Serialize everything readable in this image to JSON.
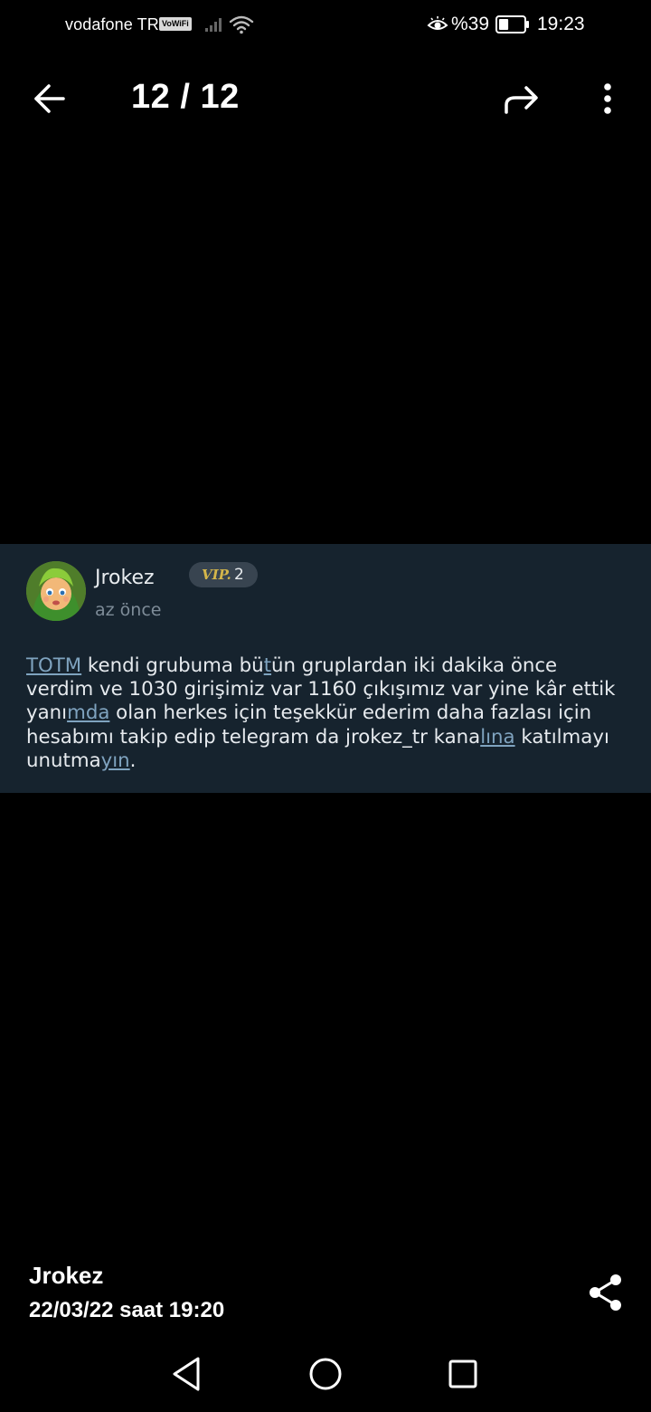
{
  "status_bar": {
    "carrier": "vodafone TR",
    "vowifi": "VoWiFi",
    "battery_percent": "%39",
    "battery_level": 0.39,
    "time": "19:23"
  },
  "app_bar": {
    "page_counter": "12 / 12"
  },
  "post": {
    "username": "Jrokez",
    "vip_logo": "VIP.",
    "vip_level": "2",
    "relative_time": "az önce",
    "body": [
      {
        "text": "TOTM",
        "link": true
      },
      {
        "text": " kendi grubuma bü",
        "link": false
      },
      {
        "text": "t",
        "link": true
      },
      {
        "text": "ün gruplardan iki dakika önce verdim ve 1030 girişimiz var 1160 çıkışımız var yine kâr ettik yanı",
        "link": false
      },
      {
        "text": "mda",
        "link": true
      },
      {
        "text": " olan herkes için teşekkür ederim daha fazlası için hesabımı takip edip telegram da jrokez_tr kana",
        "link": false
      },
      {
        "text": "lına",
        "link": true
      },
      {
        "text": " katılmayı unutma",
        "link": false
      },
      {
        "text": "yın",
        "link": true
      },
      {
        "text": ".",
        "link": false
      }
    ]
  },
  "footer": {
    "author": "Jrokez",
    "date": "22/03/22 saat 19:20"
  },
  "icons": {
    "back": "arrow-left-icon",
    "forward": "forward-arrow-icon",
    "more": "more-vert-icon",
    "share": "share-icon",
    "nav_back": "triangle-back-icon",
    "nav_home": "circle-home-icon",
    "nav_recents": "square-recents-icon"
  },
  "colors": {
    "background": "#000000",
    "card_background": "#16232e",
    "link": "#7fa3bf",
    "muted_text": "#7e8c98",
    "vip_gold": "#d4b64a"
  }
}
